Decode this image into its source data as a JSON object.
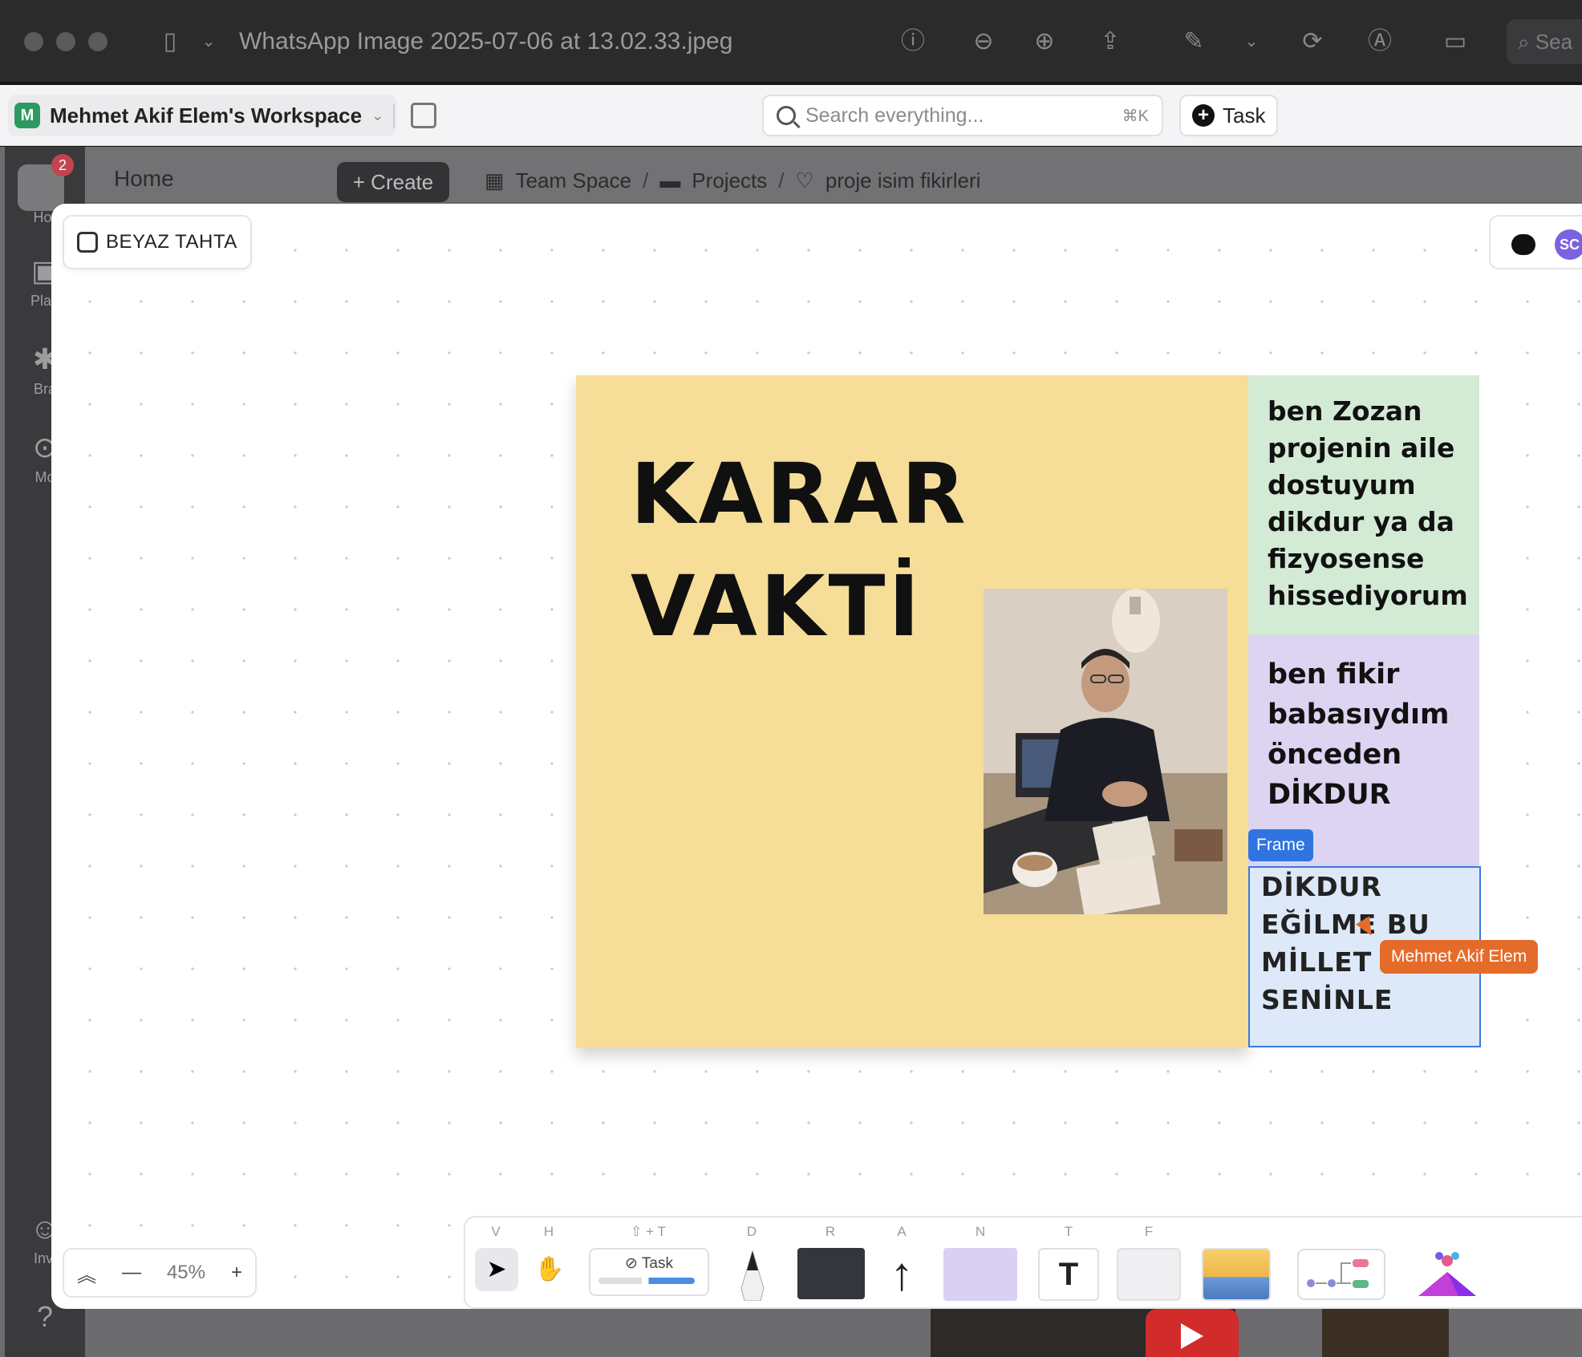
{
  "window": {
    "title": "WhatsApp Image 2025-07-06 at 13.02.33.jpeg",
    "search_partial": "Sea"
  },
  "workspace": {
    "badge": "M",
    "name": "Mehmet Akif Elem's Workspace"
  },
  "search": {
    "placeholder": "Search everything...",
    "shortcut": "⌘K"
  },
  "task_button": {
    "label": "Task"
  },
  "sidebar": {
    "notification_count": "2",
    "items": [
      {
        "label": "Hor"
      },
      {
        "label": "Plan"
      },
      {
        "label": "Bra"
      },
      {
        "label": "Mo"
      },
      {
        "label": "Invi"
      }
    ]
  },
  "header": {
    "home_label": "Home",
    "create_label": "+ Create",
    "breadcrumb": [
      "Team Space",
      "Projects",
      "proje isim fikirleri"
    ]
  },
  "board": {
    "title": "BEYAZ TAHTA",
    "collaborator_initials": "SC",
    "yellow_frame": {
      "line1": "KARAR",
      "line2": "VAKTİ"
    },
    "sticky_green": "ben Zozan\nprojenin aile\ndostuyum\ndikdur ya da\nfizyosense\nhissediyorum",
    "sticky_purple": "ben fikir\nbabasıydım\nönceden\nDİKDUR",
    "frame_tag": "Frame",
    "blue_frame_text": "DİKDUR\nEĞİLME BU\nMİLLET\nSENİNLE",
    "cursor_user": "Mehmet Akif Elem"
  },
  "zoom": {
    "level": "45%"
  },
  "toolbar": {
    "keys": [
      "V",
      "H",
      "⇧ + T",
      "D",
      "R",
      "A",
      "N",
      "T",
      "F"
    ],
    "task_card_label": "Task"
  },
  "colors": {
    "sticky_yellow": "#f6dd98",
    "sticky_green": "#d3ead5",
    "sticky_purple": "#ddd4f2",
    "frame_blue": "#2f74e0",
    "cursor_orange": "#e56b2a"
  }
}
